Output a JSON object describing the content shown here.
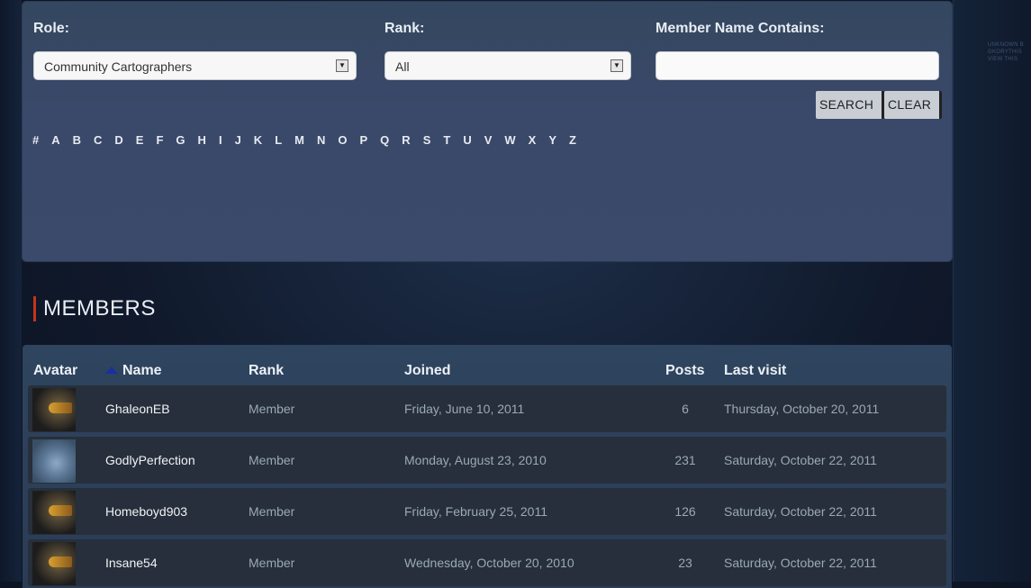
{
  "filters": {
    "role_label": "Role:",
    "role_value": "Community Cartographers",
    "rank_label": "Rank:",
    "rank_value": "All",
    "name_label": "Member Name Contains:",
    "name_value": "",
    "search_label": "SEARCH",
    "clear_label": "CLEAR"
  },
  "alphabet": [
    "#",
    "A",
    "B",
    "C",
    "D",
    "E",
    "F",
    "G",
    "H",
    "I",
    "J",
    "K",
    "L",
    "M",
    "N",
    "O",
    "P",
    "Q",
    "R",
    "S",
    "T",
    "U",
    "V",
    "W",
    "X",
    "Y",
    "Z"
  ],
  "side_text": "UNKNOWN B GKORYTHIS VIEW THIS",
  "members": {
    "heading": "MEMBERS",
    "columns": {
      "avatar": "Avatar",
      "name": "Name",
      "rank": "Rank",
      "joined": "Joined",
      "posts": "Posts",
      "last_visit": "Last visit"
    },
    "sort_icon": "sort-ascending-icon",
    "rows": [
      {
        "avatar": "helmet",
        "name": "GhaleonEB",
        "rank": "Member",
        "joined": "Friday, June 10, 2011",
        "posts": "6",
        "last_visit": "Thursday, October 20, 2011"
      },
      {
        "avatar": "eye",
        "name": "GodlyPerfection",
        "rank": "Member",
        "joined": "Monday, August 23, 2010",
        "posts": "231",
        "last_visit": "Saturday, October 22, 2011"
      },
      {
        "avatar": "helmet",
        "name": "Homeboyd903",
        "rank": "Member",
        "joined": "Friday, February 25, 2011",
        "posts": "126",
        "last_visit": "Saturday, October 22, 2011"
      },
      {
        "avatar": "helmet",
        "name": "Insane54",
        "rank": "Member",
        "joined": "Wednesday, October 20, 2010",
        "posts": "23",
        "last_visit": "Saturday, October 22, 2011"
      }
    ]
  },
  "colors": {
    "accent_bar": "#c4341a",
    "sort_arrow": "#1b2fa0",
    "row_bg": "#262f3b"
  }
}
